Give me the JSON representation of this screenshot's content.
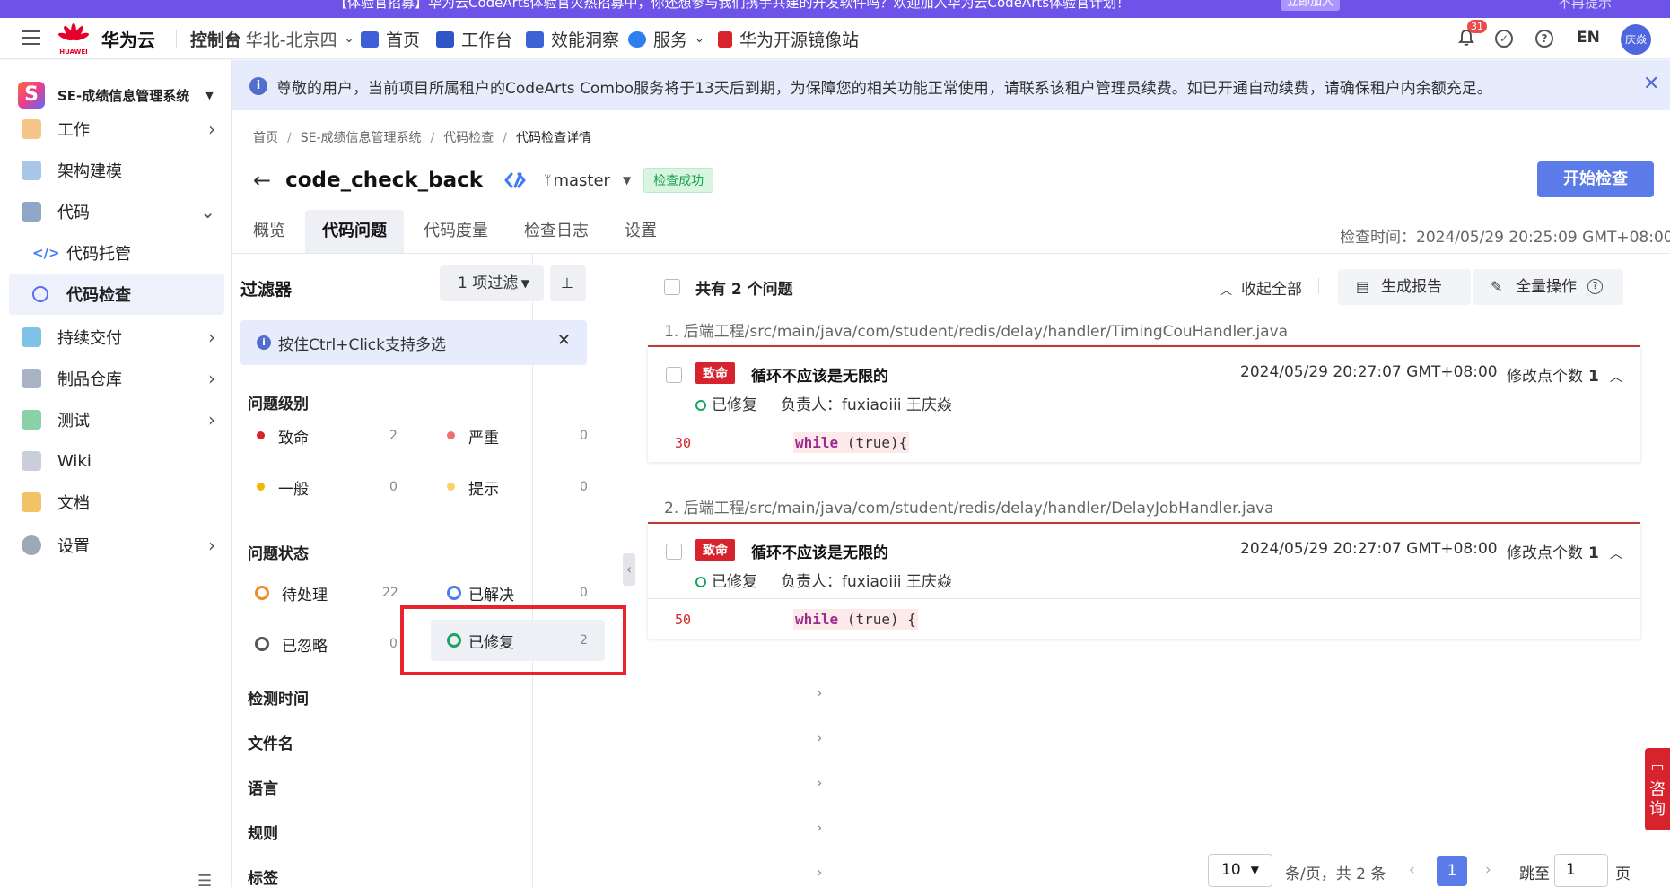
{
  "promo": {
    "text": "【体验官招募】华为云CodeArts体验官火热招募中，你还想参与我们携手共建的开发软件吗？欢迎加入华为云CodeArts体验官计划！",
    "button": "立即加入",
    "right_text": "不再提示"
  },
  "header": {
    "brand": "华为云",
    "logo_text": "HUAWEI",
    "console": "控制台",
    "region": "华北-北京四",
    "nav": [
      "首页",
      "工作台",
      "效能洞察",
      "服务",
      "华为开源镜像站"
    ],
    "notifications_count": "31",
    "lang": "EN",
    "avatar": "庆焱"
  },
  "sidebar": {
    "project": "SE-成绩信息管理系统",
    "items": [
      {
        "label": "工作",
        "icon": "work-icon",
        "chevron": "›"
      },
      {
        "label": "架构建模",
        "icon": "architecture-icon",
        "chevron": ""
      },
      {
        "label": "代码",
        "icon": "code-icon",
        "chevron": "⌄"
      },
      {
        "label": "代码托管",
        "icon": "repo-icon",
        "chevron": ""
      },
      {
        "label": "代码检查",
        "icon": "code-check-icon",
        "chevron": ""
      },
      {
        "label": "持续交付",
        "icon": "delivery-icon",
        "chevron": "›"
      },
      {
        "label": "制品仓库",
        "icon": "artifact-icon",
        "chevron": "›"
      },
      {
        "label": "测试",
        "icon": "test-icon",
        "chevron": "›"
      },
      {
        "label": "Wiki",
        "icon": "wiki-icon",
        "chevron": ""
      },
      {
        "label": "文档",
        "icon": "docs-icon",
        "chevron": ""
      },
      {
        "label": "设置",
        "icon": "settings-icon",
        "chevron": "›"
      }
    ]
  },
  "notice": {
    "text": "尊敬的用户，当前项目所属租户的CodeArts Combo服务将于13天后到期，为保障您的相关功能正常使用，请联系该租户管理员续费。如已开通自动续费，请确保租户内余额充足。",
    "close": "✕"
  },
  "breadcrumb": [
    "首页",
    "SE-成绩信息管理系统",
    "代码检查",
    "代码检查详情"
  ],
  "task": {
    "name": "code_check_back",
    "branch": "master",
    "status": "检查成功",
    "start_button": "开始检查",
    "check_time": "检查时间：2024/05/29 20:25:09 GMT+08:00"
  },
  "tabs": [
    "概览",
    "代码问题",
    "代码度量",
    "检查日志",
    "设置"
  ],
  "filter": {
    "title": "过滤器",
    "select": "1 项过滤",
    "tip": "按住Ctrl+Click支持多选",
    "level_title": "问题级别",
    "levels": [
      {
        "label": "致命",
        "count": "2",
        "color": "#d7232d"
      },
      {
        "label": "严重",
        "count": "0",
        "color": "#f0706a"
      },
      {
        "label": "一般",
        "count": "0",
        "color": "#f5b400"
      },
      {
        "label": "提示",
        "count": "0",
        "color": "#f5d36a"
      }
    ],
    "status_title": "问题状态",
    "statuses": [
      {
        "label": "待处理",
        "count": "22",
        "color": "#f08a24"
      },
      {
        "label": "已解决",
        "count": "0",
        "color": "#4a7cf0"
      },
      {
        "label": "已忽略",
        "count": "0",
        "color": "#555555"
      },
      {
        "label": "已修复",
        "count": "2",
        "color": "#19a45f"
      }
    ],
    "more_sections": [
      "检测时间",
      "文件名",
      "语言",
      "规则",
      "标签"
    ]
  },
  "issues": {
    "total": "共有 2 个问题",
    "collapse_all": "收起全部",
    "report_button": "生成报告",
    "bulk_button": "全量操作",
    "items": [
      {
        "file": "1. 后端工程/src/main/java/com/student/redis/delay/handler/TimingCouHandler.java",
        "severity": "致命",
        "rule": "循环不应该是无限的",
        "time": "2024/05/29 20:27:07 GMT+08:00",
        "mod_label": "修改点个数",
        "mod_count": "1",
        "status": "已修复",
        "owner": "负责人：fuxiaoiii 王庆焱",
        "line": "30",
        "code_kw": "while",
        "code_rest": " (true){",
        "code_kw2": "true"
      },
      {
        "file": "2. 后端工程/src/main/java/com/student/redis/delay/handler/DelayJobHandler.java",
        "severity": "致命",
        "rule": "循环不应该是无限的",
        "time": "2024/05/29 20:27:07 GMT+08:00",
        "mod_label": "修改点个数",
        "mod_count": "1",
        "status": "已修复",
        "owner": "负责人：fuxiaoiii 王庆焱",
        "line": "50",
        "code_kw": "while",
        "code_rest": " (true) {",
        "code_kw2": "true"
      }
    ]
  },
  "pagination": {
    "page_size": "10",
    "summary": "条/页，共 2 条",
    "current": "1",
    "jump_label": "跳至",
    "jump_value": "1",
    "page_suffix": "页"
  },
  "consult": "咨询"
}
